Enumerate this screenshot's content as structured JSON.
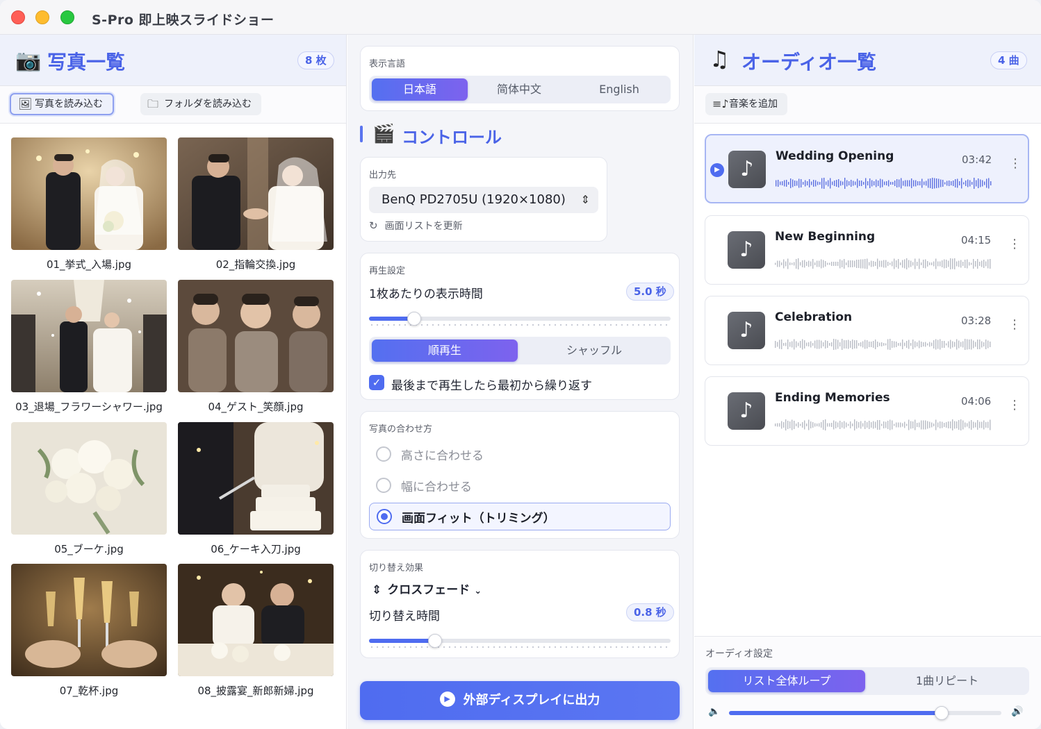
{
  "app": {
    "title": "S-Pro 即上映スライドショー"
  },
  "photos": {
    "title": "写真一覧",
    "count": "8 枚",
    "load_photos": "写真を読み込む",
    "load_folder": "フォルダを読み込む",
    "items": [
      {
        "name": "01_挙式_入場.jpg"
      },
      {
        "name": "02_指輪交換.jpg"
      },
      {
        "name": "03_退場_フラワーシャワー.jpg"
      },
      {
        "name": "04_ゲスト_笑顔.jpg"
      },
      {
        "name": "05_ブーケ.jpg"
      },
      {
        "name": "06_ケーキ入刀.jpg"
      },
      {
        "name": "07_乾杯.jpg"
      },
      {
        "name": "08_披露宴_新郎新婦.jpg"
      }
    ]
  },
  "language": {
    "label": "表示言語",
    "options": [
      "日本語",
      "简体中文",
      "English"
    ],
    "selected": "日本語"
  },
  "control": {
    "title": "コントロール"
  },
  "output": {
    "label": "出力先",
    "display": "BenQ PD2705U (1920×1080)",
    "refresh": "画面リストを更新"
  },
  "playback": {
    "label": "再生設定",
    "duration_label": "1枚あたりの表示時間",
    "duration_value": "5.0 秒",
    "duration_fraction": 0.15,
    "order_options": [
      "順再生",
      "シャッフル"
    ],
    "order_selected": "順再生",
    "loop_label": "最後まで再生したら最初から繰り返す",
    "loop_checked": true
  },
  "fit": {
    "label": "写真の合わせ方",
    "options": [
      "高さに合わせる",
      "幅に合わせる",
      "画面フィット（トリミング）"
    ],
    "selected": "画面フィット（トリミング）"
  },
  "transition": {
    "label": "切り替え効果",
    "effect": "クロスフェード",
    "time_label": "切り替え時間",
    "time_value": "0.8 秒",
    "time_fraction": 0.22
  },
  "output_button": {
    "label": "外部ディスプレイに出力"
  },
  "audio": {
    "title": "オーディオ一覧",
    "count": "4 曲",
    "add_music": "音楽を追加",
    "tracks": [
      {
        "title": "Wedding Opening",
        "time": "03:42",
        "active": true
      },
      {
        "title": "New Beginning",
        "time": "04:15",
        "active": false
      },
      {
        "title": "Celebration",
        "time": "03:28",
        "active": false
      },
      {
        "title": "Ending Memories",
        "time": "04:06",
        "active": false
      }
    ],
    "settings_label": "オーディオ設定",
    "loop_options": [
      "リスト全体ループ",
      "1曲リピート"
    ],
    "loop_selected": "リスト全体ループ",
    "volume_fraction": 0.78
  },
  "icons": {
    "camera": "camera-icon",
    "clapper": "clapperboard-icon",
    "music": "music-note-icon",
    "photo": "image-icon",
    "folder": "folder-icon",
    "refresh": "refresh-icon",
    "volume_low": "volume-low-icon",
    "volume_high": "volume-high-icon"
  },
  "colors": {
    "accent": "#4f6cf0",
    "title_blue": "#4a63e7"
  }
}
